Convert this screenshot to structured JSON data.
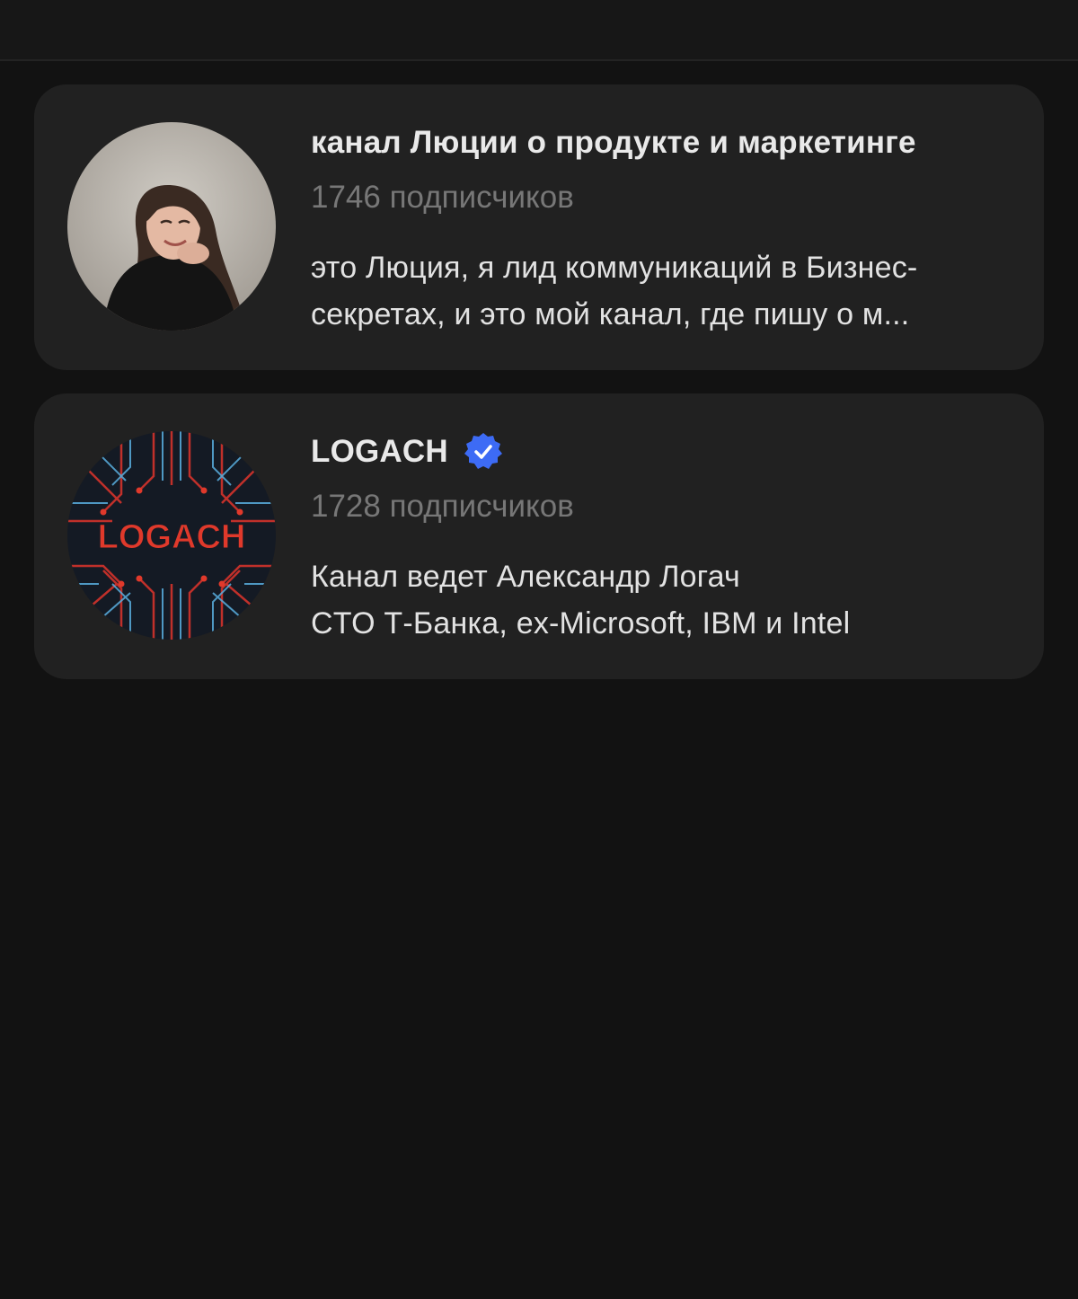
{
  "channels": [
    {
      "title": "канал Люции о продукте и маркетинге",
      "verified": false,
      "subscribers": "1746 подписчиков",
      "description_lines": [
        "это Люция, я лид коммуникаций в Бизнес-",
        "секретах, и это мой канал, где пишу о м..."
      ],
      "avatar_icon": "person-photo-avatar"
    },
    {
      "title": "LOGACH",
      "verified": true,
      "subscribers": "1728 подписчиков",
      "description_lines": [
        "Канал ведет Александр Логач",
        "CTO Т-Банка, ex-Microsoft, IBM и Intel"
      ],
      "avatar_logo_text": "LOGACH",
      "avatar_icon": "circuit-logo-avatar"
    }
  ],
  "colors": {
    "background": "#121212",
    "card": "#212121",
    "title": "#e9e9e9",
    "muted": "#777777",
    "verified": "#3d6bf5",
    "logo_red": "#e0392b"
  }
}
